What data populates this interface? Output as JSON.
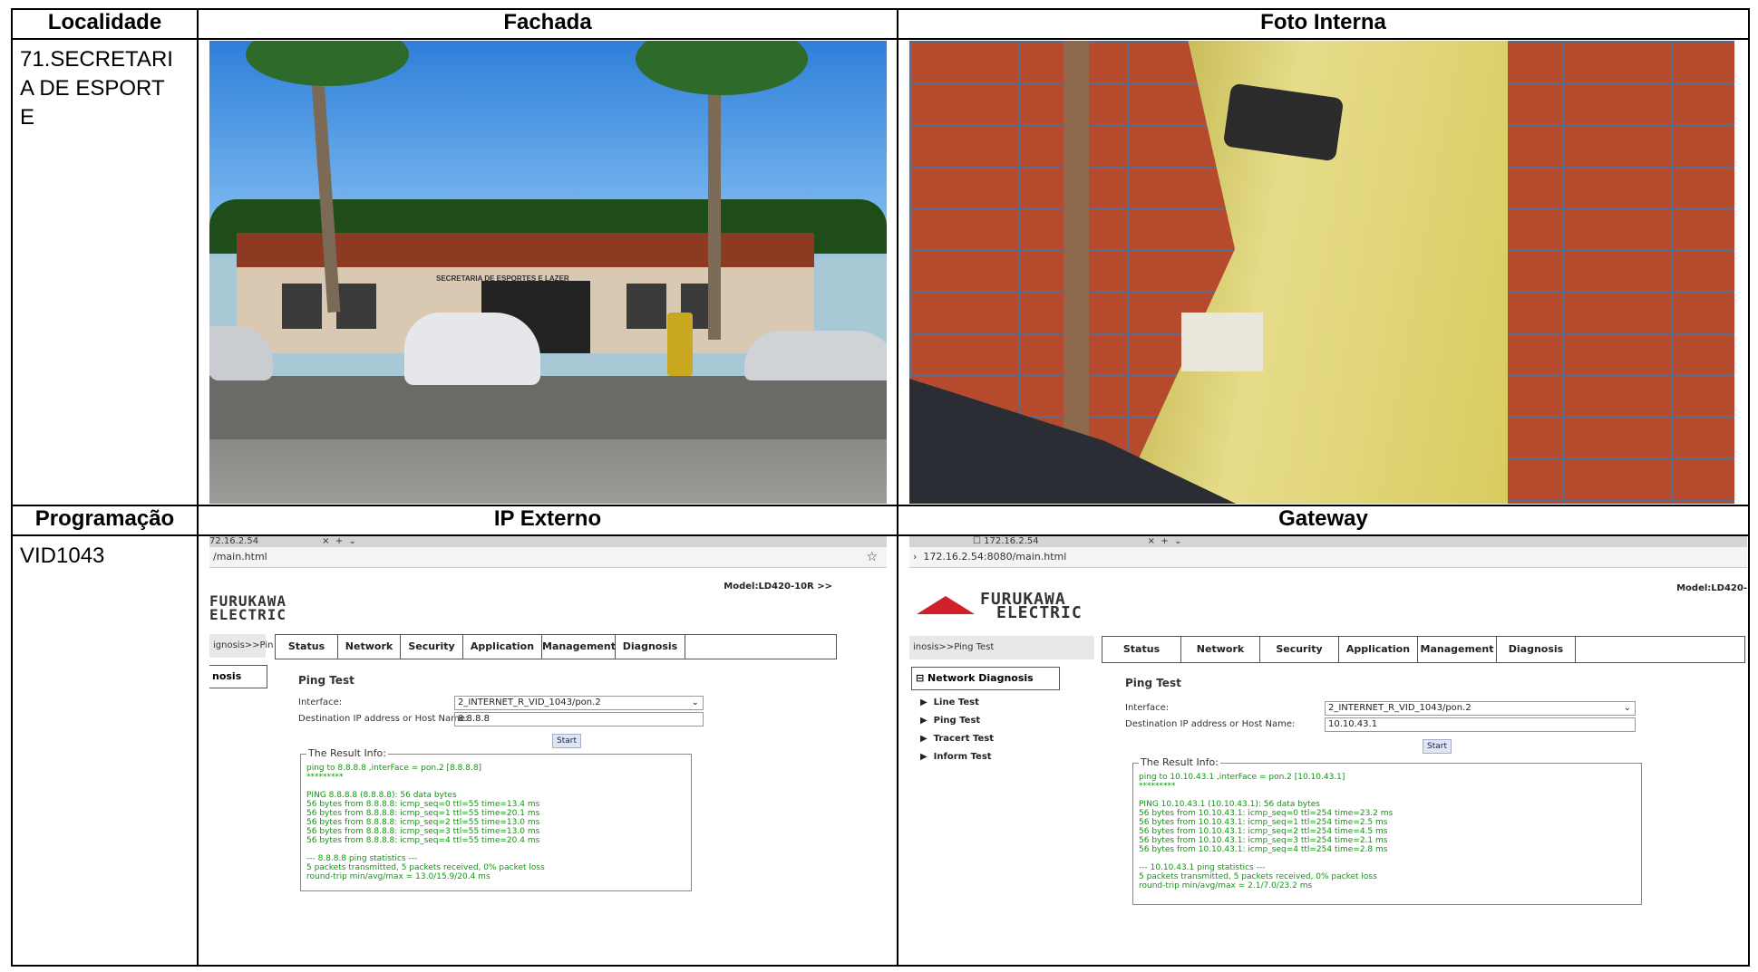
{
  "headers": {
    "row1": [
      "Localidade",
      "Fachada",
      "Foto Interna"
    ],
    "row2": [
      "Programação",
      "IP Externo",
      "Gateway"
    ]
  },
  "localidade": "71.SECRETARIA DE ESPORTE",
  "programacao": "VID1043",
  "ip_externo": {
    "tab": "72.16.2.54",
    "url": "/main.html",
    "model": "Model:LD420-10R >>",
    "brand_line1": "FURUKAWA",
    "brand_line2": "ELECTRIC",
    "crumb": "ignosis>>Pin",
    "side_box": "nosis",
    "nav": [
      "Status",
      "Network",
      "Security",
      "Application",
      "Management",
      "Diagnosis"
    ],
    "page_title": "Ping Test",
    "interface_label": "Interface:",
    "interface_value": "2_INTERNET_R_VID_1043/pon.2",
    "dest_label": "Destination IP address or Host Name:",
    "dest_value": "8.8.8.8",
    "start": "Start",
    "result_legend": "The Result Info:",
    "result_lines": [
      "ping to 8.8.8.8 ,interFace = pon.2 [8.8.8.8]",
      "*********",
      "",
      "PING 8.8.8.8 (8.8.8.8): 56 data bytes",
      "56 bytes from 8.8.8.8: icmp_seq=0 ttl=55 time=13.4 ms",
      "56 bytes from 8.8.8.8: icmp_seq=1 ttl=55 time=20.1 ms",
      "56 bytes from 8.8.8.8: icmp_seq=2 ttl=55 time=13.0 ms",
      "56 bytes from 8.8.8.8: icmp_seq=3 ttl=55 time=13.0 ms",
      "56 bytes from 8.8.8.8: icmp_seq=4 ttl=55 time=20.4 ms",
      "",
      "--- 8.8.8.8 ping statistics ---",
      "5 packets transmitted, 5 packets received, 0% packet loss",
      "round-trip min/avg/max = 13.0/15.9/20.4 ms"
    ]
  },
  "gateway": {
    "tab": "172.16.2.54",
    "url": "172.16.2.54:8080/main.html",
    "model": "Model:LD420-",
    "brand_line1": "FURUKAWA",
    "brand_line2": "ELECTRIC",
    "crumb": "inosis>>Ping Test",
    "side_box": "Network Diagnosis",
    "side_items": [
      "Line Test",
      "Ping Test",
      "Tracert Test",
      "Inform Test"
    ],
    "nav": [
      "Status",
      "Network",
      "Security",
      "Application",
      "Management",
      "Diagnosis"
    ],
    "page_title": "Ping Test",
    "interface_label": "Interface:",
    "interface_value": "2_INTERNET_R_VID_1043/pon.2",
    "dest_label": "Destination IP address or Host Name:",
    "dest_value": "10.10.43.1",
    "start": "Start",
    "result_legend": "The Result Info:",
    "result_lines": [
      "ping to 10.10.43.1 ,interFace = pon.2 [10.10.43.1]",
      "*********",
      "",
      "PING 10.10.43.1 (10.10.43.1): 56 data bytes",
      "56 bytes from 10.10.43.1: icmp_seq=0 ttl=254 time=23.2 ms",
      "56 bytes from 10.10.43.1: icmp_seq=1 ttl=254 time=2.5 ms",
      "56 bytes from 10.10.43.1: icmp_seq=2 ttl=254 time=4.5 ms",
      "56 bytes from 10.10.43.1: icmp_seq=3 ttl=254 time=2.1 ms",
      "56 bytes from 10.10.43.1: icmp_seq=4 ttl=254 time=2.8 ms",
      "",
      "--- 10.10.43.1 ping statistics ---",
      "5 packets transmitted, 5 packets received, 0% packet loss",
      "round-trip min/avg/max = 2.1/7.0/23.2 ms"
    ]
  },
  "photo_fachada_sign": "SECRETARIA DE ESPORTES E LAZER"
}
